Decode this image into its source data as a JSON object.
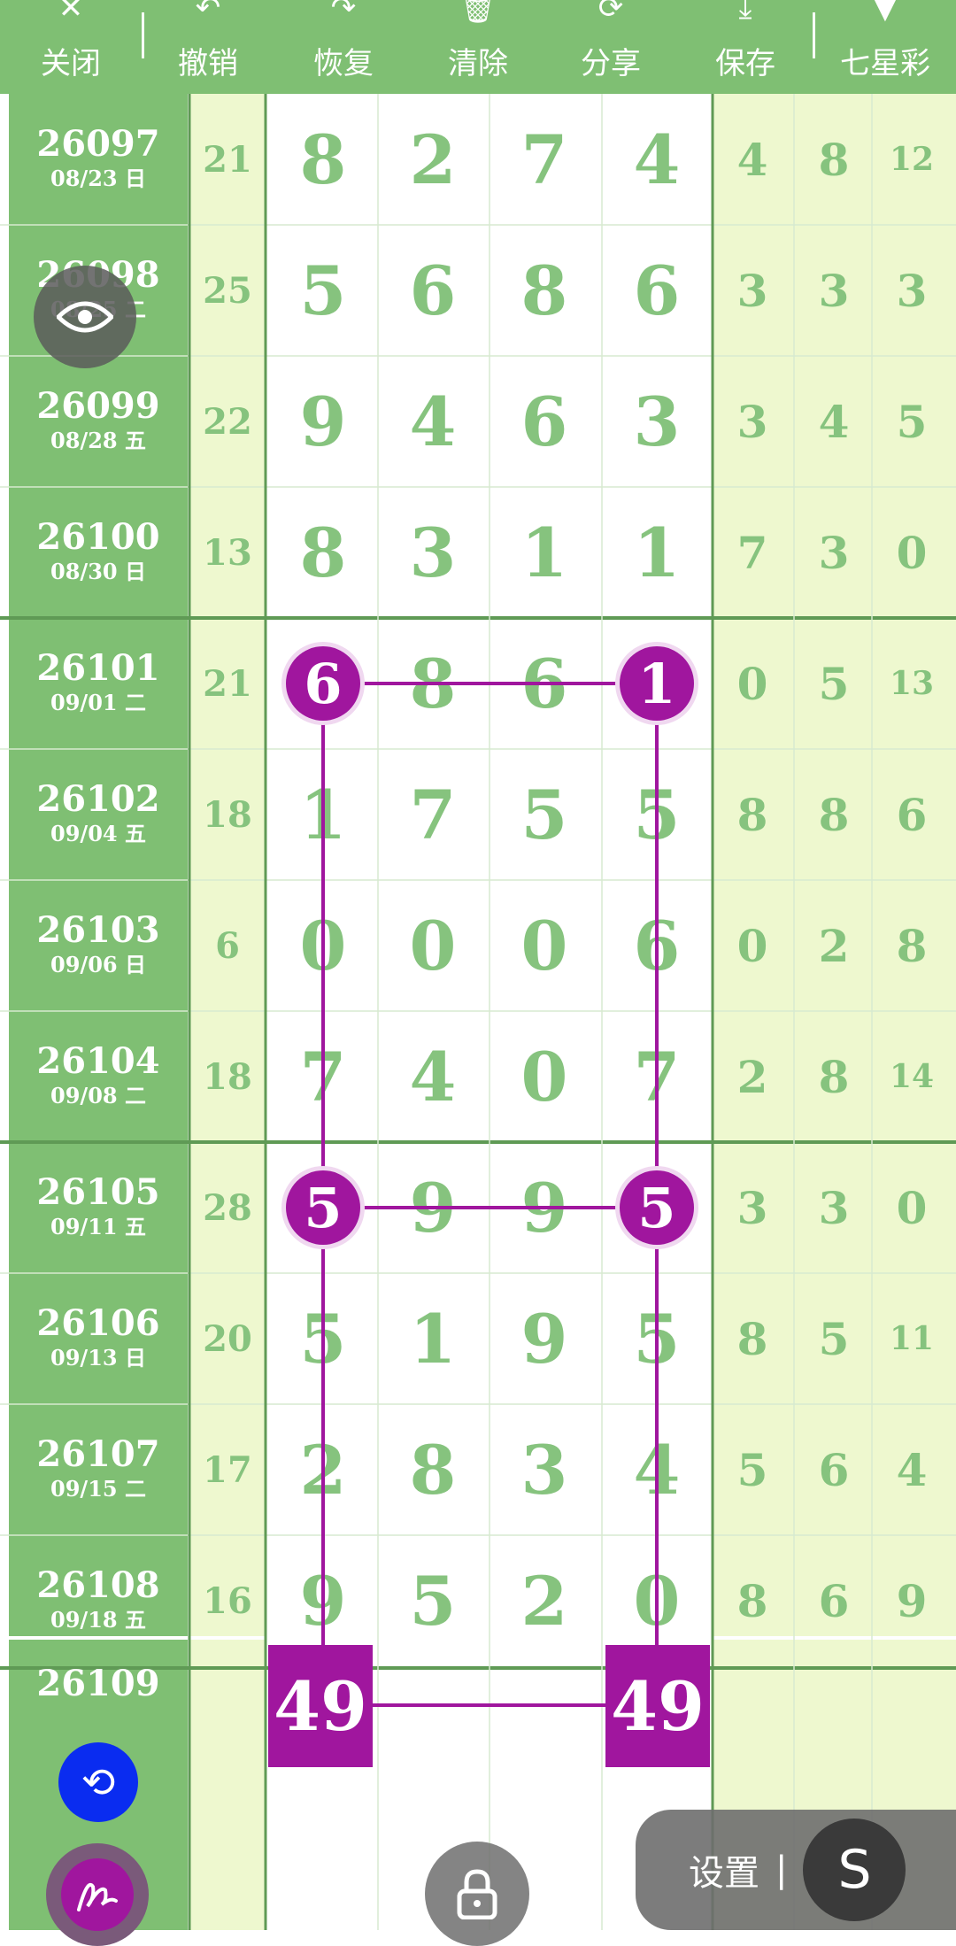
{
  "toolbar": {
    "items": [
      {
        "label": "关闭",
        "icon": "close-icon",
        "glyph": "✕"
      },
      {
        "label": "撤销",
        "icon": "undo-icon",
        "glyph": "↶"
      },
      {
        "label": "恢复",
        "icon": "redo-icon",
        "glyph": "↷"
      },
      {
        "label": "清除",
        "icon": "trash-icon",
        "glyph": "🗑"
      },
      {
        "label": "分享",
        "icon": "share-icon",
        "glyph": "⟳"
      },
      {
        "label": "保存",
        "icon": "download-icon",
        "glyph": "⤓"
      },
      {
        "label": "七星彩",
        "icon": "dropdown-triangle-icon",
        "glyph": "▼"
      }
    ]
  },
  "rows": [
    {
      "issue": "26097",
      "date": "08/23 日",
      "sum": "21",
      "nums": [
        "8",
        "2",
        "7",
        "4"
      ],
      "diffs": [
        "4",
        "8",
        "12"
      ]
    },
    {
      "issue": "26098",
      "date": "08/25 二",
      "sum": "25",
      "nums": [
        "5",
        "6",
        "8",
        "6"
      ],
      "diffs": [
        "3",
        "3",
        "3"
      ]
    },
    {
      "issue": "26099",
      "date": "08/28 五",
      "sum": "22",
      "nums": [
        "9",
        "4",
        "6",
        "3"
      ],
      "diffs": [
        "3",
        "4",
        "5"
      ]
    },
    {
      "issue": "26100",
      "date": "08/30 日",
      "sum": "13",
      "nums": [
        "8",
        "3",
        "1",
        "1"
      ],
      "diffs": [
        "7",
        "3",
        "0"
      ]
    },
    {
      "issue": "26101",
      "date": "09/01 二",
      "sum": "21",
      "nums": [
        "6",
        "8",
        "6",
        "1"
      ],
      "diffs": [
        "0",
        "5",
        "13"
      ]
    },
    {
      "issue": "26102",
      "date": "09/04 五",
      "sum": "18",
      "nums": [
        "1",
        "7",
        "5",
        "5"
      ],
      "diffs": [
        "8",
        "8",
        "6"
      ]
    },
    {
      "issue": "26103",
      "date": "09/06 日",
      "sum": "6",
      "nums": [
        "0",
        "0",
        "0",
        "6"
      ],
      "diffs": [
        "0",
        "2",
        "8"
      ]
    },
    {
      "issue": "26104",
      "date": "09/08 二",
      "sum": "18",
      "nums": [
        "7",
        "4",
        "0",
        "7"
      ],
      "diffs": [
        "2",
        "8",
        "14"
      ]
    },
    {
      "issue": "26105",
      "date": "09/11 五",
      "sum": "28",
      "nums": [
        "5",
        "9",
        "9",
        "5"
      ],
      "diffs": [
        "3",
        "3",
        "0"
      ]
    },
    {
      "issue": "26106",
      "date": "09/13 日",
      "sum": "20",
      "nums": [
        "5",
        "1",
        "9",
        "5"
      ],
      "diffs": [
        "8",
        "5",
        "11"
      ]
    },
    {
      "issue": "26107",
      "date": "09/15 二",
      "sum": "17",
      "nums": [
        "2",
        "8",
        "3",
        "4"
      ],
      "diffs": [
        "5",
        "6",
        "4"
      ]
    },
    {
      "issue": "26108",
      "date": "09/18 五",
      "sum": "16",
      "nums": [
        "9",
        "5",
        "2",
        "0"
      ],
      "diffs": [
        "8",
        "6",
        "9"
      ]
    }
  ],
  "highlights": [
    {
      "row": 4,
      "col": 0,
      "value": "6"
    },
    {
      "row": 4,
      "col": 3,
      "value": "1"
    },
    {
      "row": 8,
      "col": 0,
      "value": "5"
    },
    {
      "row": 8,
      "col": 3,
      "value": "5"
    }
  ],
  "prediction": {
    "issue": "26109",
    "left_value": "49",
    "right_value": "49"
  },
  "settings": {
    "label": "设置",
    "sep": "|",
    "logo": "S"
  },
  "colors": {
    "green": "#7fbf73",
    "light_green": "#eef8cf",
    "number_green": "#86c37e",
    "purple": "#a0169e",
    "blue": "#0a2cf0"
  }
}
